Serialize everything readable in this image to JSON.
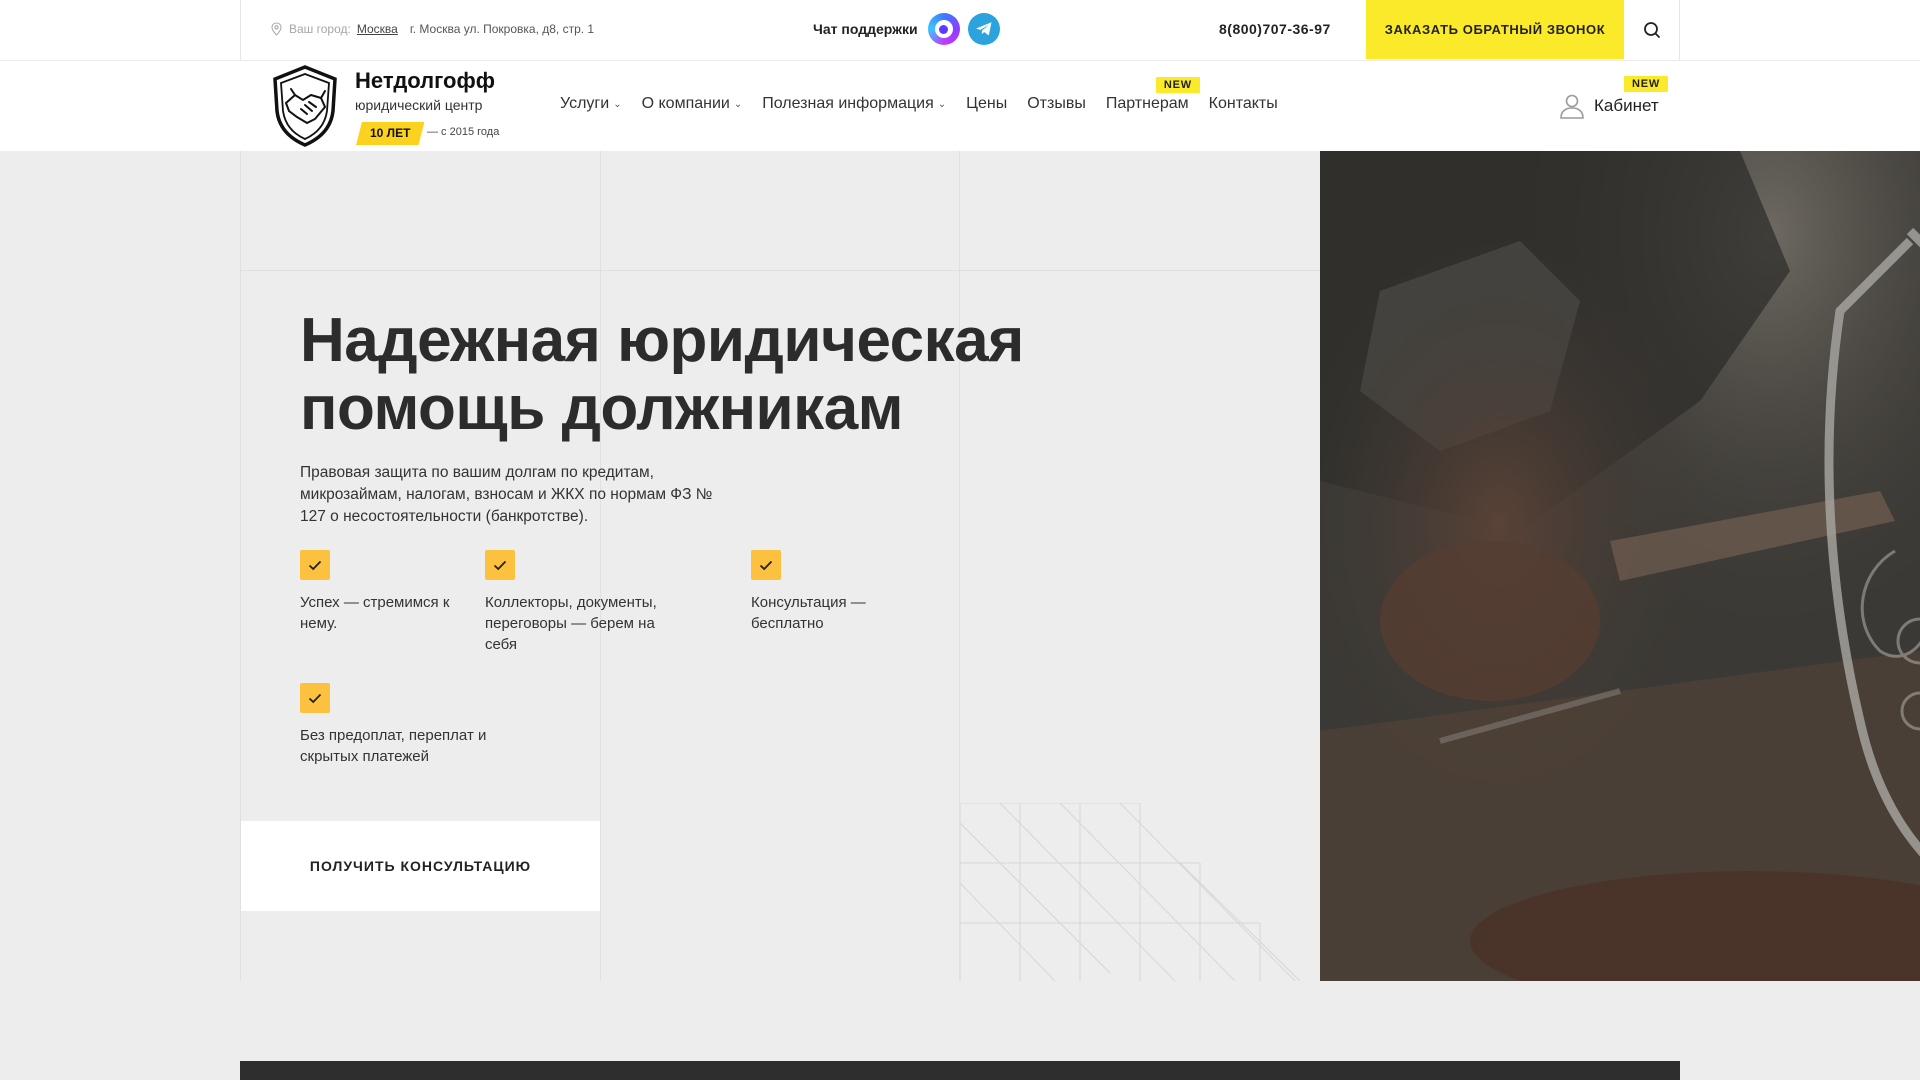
{
  "topbar": {
    "city_label": "Ваш город:",
    "city_name": "Москва",
    "address": "г. Москва ул. Покровка, д8, стр. 1",
    "support_label": "Чат поддержки",
    "phone": "8(800)707-36-97",
    "callback_label": "ЗАКАЗАТЬ ОБРАТНЫЙ ЗВОНОК"
  },
  "brand": {
    "name": "Нетдолгофф",
    "subtitle": "юридический центр",
    "years_badge": "10 ЛЕТ",
    "since": "— с 2015 года"
  },
  "nav": {
    "items": [
      {
        "label": "Услуги",
        "dropdown": true
      },
      {
        "label": "О компании",
        "dropdown": true
      },
      {
        "label": "Полезная информация",
        "dropdown": true
      },
      {
        "label": "Цены",
        "dropdown": false
      },
      {
        "label": "Отзывы",
        "dropdown": false
      },
      {
        "label": "Партнерам",
        "dropdown": false
      },
      {
        "label": "Контакты",
        "dropdown": false
      }
    ],
    "partners_badge": "NEW",
    "cabinet_label": "Кабинет",
    "cabinet_badge": "NEW"
  },
  "hero": {
    "title_line1": "Надежная юридическая",
    "title_line2": "помощь должникам",
    "description": "Правовая защита по вашим долгам по кредитам, микрозаймам, налогам, взносам и ЖКХ по нормам ФЗ № 127 о несостоятельности (банкротстве).",
    "features": [
      "Успех — стремимся к нему.",
      "Коллекторы, документы, переговоры — берем на себя",
      "Консультация — бесплатно",
      "Без предоплат, переплат и скрытых платежей"
    ],
    "cta_label": "ПОЛУЧИТЬ КОНСУЛЬТАЦИЮ"
  },
  "icons": {
    "location": "location-pin-icon",
    "chat_app": "chat-app-icon",
    "telegram": "telegram-icon",
    "search": "search-icon",
    "user": "user-icon",
    "check": "check-icon",
    "logo": "shield-handshake-logo"
  },
  "colors": {
    "accent_yellow": "#fbea2a",
    "check_orange": "#fbc13f",
    "badge_yellow": "#fbd21e",
    "telegram_blue": "#2aa3df",
    "dark_band": "#2e2e2e"
  }
}
